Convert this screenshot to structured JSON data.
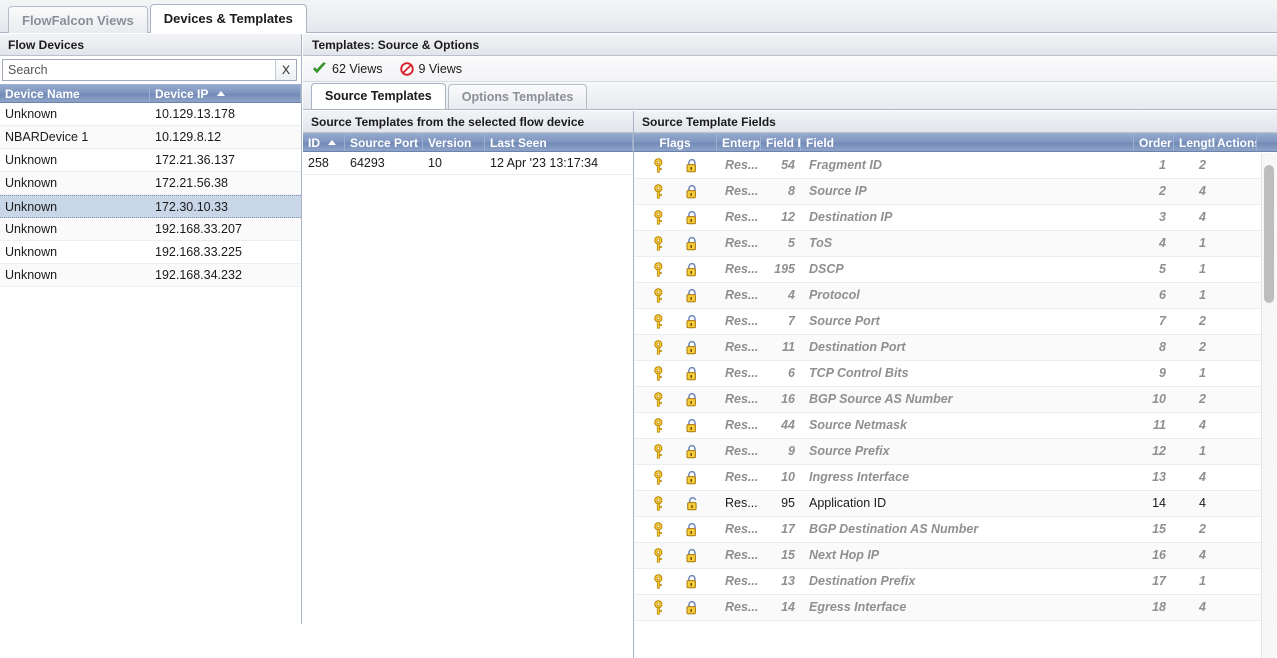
{
  "top_tabs": [
    {
      "label": "FlowFalcon Views",
      "active": false
    },
    {
      "label": "Devices & Templates",
      "active": true
    }
  ],
  "left_panel": {
    "title": "Flow Devices",
    "search": {
      "placeholder": "Search",
      "value": "",
      "clear_label": "X",
      "clear_icon": "close-icon"
    },
    "columns": [
      {
        "label": "Device Name",
        "sorted": false
      },
      {
        "label": "Device IP",
        "sorted": true,
        "sort_dir": "asc"
      }
    ],
    "rows": [
      {
        "name": "Unknown",
        "ip": "10.129.13.178",
        "selected": false
      },
      {
        "name": "NBARDevice 1",
        "ip": "10.129.8.12",
        "selected": false
      },
      {
        "name": "Unknown",
        "ip": "172.21.36.137",
        "selected": false
      },
      {
        "name": "Unknown",
        "ip": "172.21.56.38",
        "selected": false
      },
      {
        "name": "Unknown",
        "ip": "172.30.10.33",
        "selected": true
      },
      {
        "name": "Unknown",
        "ip": "192.168.33.207",
        "selected": false
      },
      {
        "name": "Unknown",
        "ip": "192.168.33.225",
        "selected": false
      },
      {
        "name": "Unknown",
        "ip": "192.168.34.232",
        "selected": false
      }
    ]
  },
  "right_panel": {
    "title": "Templates: Source & Options",
    "views": [
      {
        "icon": "check-icon",
        "label": "62 Views"
      },
      {
        "icon": "deny-icon",
        "label": "9 Views"
      }
    ],
    "tabs": [
      {
        "label": "Source Templates",
        "active": true
      },
      {
        "label": "Options Templates",
        "active": false
      }
    ],
    "source_templates": {
      "title": "Source Templates from the selected flow device",
      "columns": [
        {
          "label": "ID",
          "sorted": true,
          "sort_dir": "asc"
        },
        {
          "label": "Source Port",
          "sorted": false
        },
        {
          "label": "Version",
          "sorted": false
        },
        {
          "label": "Last Seen",
          "sorted": false
        }
      ],
      "rows": [
        {
          "id": "258",
          "source_port": "64293",
          "version": "10",
          "last_seen": "12 Apr '23 13:17:34"
        }
      ]
    },
    "template_fields": {
      "title": "Source Template Fields",
      "columns": [
        {
          "label": "Flags"
        },
        {
          "label": "Enterpri"
        },
        {
          "label": "Field ID"
        },
        {
          "label": "Field"
        },
        {
          "label": "Order"
        },
        {
          "label": "Length"
        },
        {
          "label": "Actions"
        }
      ],
      "rows": [
        {
          "key_icon": "key-icon",
          "lock_icon": "lock-closed-icon",
          "enterprise": "Res...",
          "field_id": "54",
          "field": "Fragment ID",
          "order": "1",
          "length": "2",
          "unlocked": false
        },
        {
          "key_icon": "key-icon",
          "lock_icon": "lock-closed-icon",
          "enterprise": "Res...",
          "field_id": "8",
          "field": "Source IP",
          "order": "2",
          "length": "4",
          "unlocked": false
        },
        {
          "key_icon": "key-icon",
          "lock_icon": "lock-closed-icon",
          "enterprise": "Res...",
          "field_id": "12",
          "field": "Destination IP",
          "order": "3",
          "length": "4",
          "unlocked": false
        },
        {
          "key_icon": "key-icon",
          "lock_icon": "lock-closed-icon",
          "enterprise": "Res...",
          "field_id": "5",
          "field": "ToS",
          "order": "4",
          "length": "1",
          "unlocked": false
        },
        {
          "key_icon": "key-icon",
          "lock_icon": "lock-closed-icon",
          "enterprise": "Res...",
          "field_id": "195",
          "field": "DSCP",
          "order": "5",
          "length": "1",
          "unlocked": false
        },
        {
          "key_icon": "key-icon",
          "lock_icon": "lock-closed-icon",
          "enterprise": "Res...",
          "field_id": "4",
          "field": "Protocol",
          "order": "6",
          "length": "1",
          "unlocked": false
        },
        {
          "key_icon": "key-icon",
          "lock_icon": "lock-closed-icon",
          "enterprise": "Res...",
          "field_id": "7",
          "field": "Source Port",
          "order": "7",
          "length": "2",
          "unlocked": false
        },
        {
          "key_icon": "key-icon",
          "lock_icon": "lock-closed-icon",
          "enterprise": "Res...",
          "field_id": "11",
          "field": "Destination Port",
          "order": "8",
          "length": "2",
          "unlocked": false
        },
        {
          "key_icon": "key-icon",
          "lock_icon": "lock-closed-icon",
          "enterprise": "Res...",
          "field_id": "6",
          "field": "TCP Control Bits",
          "order": "9",
          "length": "1",
          "unlocked": false
        },
        {
          "key_icon": "key-icon",
          "lock_icon": "lock-closed-icon",
          "enterprise": "Res...",
          "field_id": "16",
          "field": "BGP Source AS Number",
          "order": "10",
          "length": "2",
          "unlocked": false
        },
        {
          "key_icon": "key-icon",
          "lock_icon": "lock-closed-icon",
          "enterprise": "Res...",
          "field_id": "44",
          "field": "Source Netmask",
          "order": "11",
          "length": "4",
          "unlocked": false
        },
        {
          "key_icon": "key-icon",
          "lock_icon": "lock-closed-icon",
          "enterprise": "Res...",
          "field_id": "9",
          "field": "Source Prefix",
          "order": "12",
          "length": "1",
          "unlocked": false
        },
        {
          "key_icon": "key-icon",
          "lock_icon": "lock-closed-icon",
          "enterprise": "Res...",
          "field_id": "10",
          "field": "Ingress Interface",
          "order": "13",
          "length": "4",
          "unlocked": false
        },
        {
          "key_icon": "key-icon",
          "lock_icon": "lock-open-icon",
          "enterprise": "Res...",
          "field_id": "95",
          "field": "Application ID",
          "order": "14",
          "length": "4",
          "unlocked": true
        },
        {
          "key_icon": "key-icon",
          "lock_icon": "lock-closed-icon",
          "enterprise": "Res...",
          "field_id": "17",
          "field": "BGP Destination AS Number",
          "order": "15",
          "length": "2",
          "unlocked": false
        },
        {
          "key_icon": "key-icon",
          "lock_icon": "lock-closed-icon",
          "enterprise": "Res...",
          "field_id": "15",
          "field": "Next Hop IP",
          "order": "16",
          "length": "4",
          "unlocked": false
        },
        {
          "key_icon": "key-icon",
          "lock_icon": "lock-closed-icon",
          "enterprise": "Res...",
          "field_id": "13",
          "field": "Destination Prefix",
          "order": "17",
          "length": "1",
          "unlocked": false
        },
        {
          "key_icon": "key-icon",
          "lock_icon": "lock-closed-icon",
          "enterprise": "Res...",
          "field_id": "14",
          "field": "Egress Interface",
          "order": "18",
          "length": "4",
          "unlocked": false
        }
      ]
    }
  },
  "colors": {
    "grid_header": "#7f95bf",
    "selected_row": "#c8d6e8",
    "key_icon": "#f5c022",
    "check_icon": "#3a9e2a",
    "deny_icon": "#d8222a"
  }
}
